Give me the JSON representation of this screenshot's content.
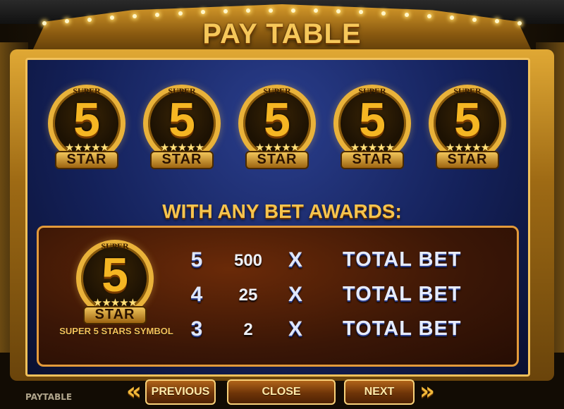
{
  "title": "PAY TABLE",
  "background_label": "PAYTABLE",
  "badge": {
    "super": "SUPER",
    "number": "5",
    "stars": "★★★★★",
    "word": "STAR"
  },
  "awards_heading": "WITH ANY BET AWARDS:",
  "symbol_label": "SUPER 5 STARS SYMBOL",
  "paytable": [
    {
      "count": "5",
      "payout": "500",
      "multiplier": "X",
      "basis": "TOTAL BET"
    },
    {
      "count": "4",
      "payout": "25",
      "multiplier": "X",
      "basis": "TOTAL BET"
    },
    {
      "count": "3",
      "payout": "2",
      "multiplier": "X",
      "basis": "TOTAL BET"
    }
  ],
  "buttons": {
    "previous": "PREVIOUS",
    "close": "CLOSE",
    "next": "NEXT"
  },
  "icons": {
    "previous_arrow": "double-chevron-left-icon",
    "next_arrow": "double-chevron-right-icon"
  },
  "colors": {
    "gold": "#f6c85a",
    "panel_blue": "#14215a",
    "award_box": "#3a1606"
  }
}
